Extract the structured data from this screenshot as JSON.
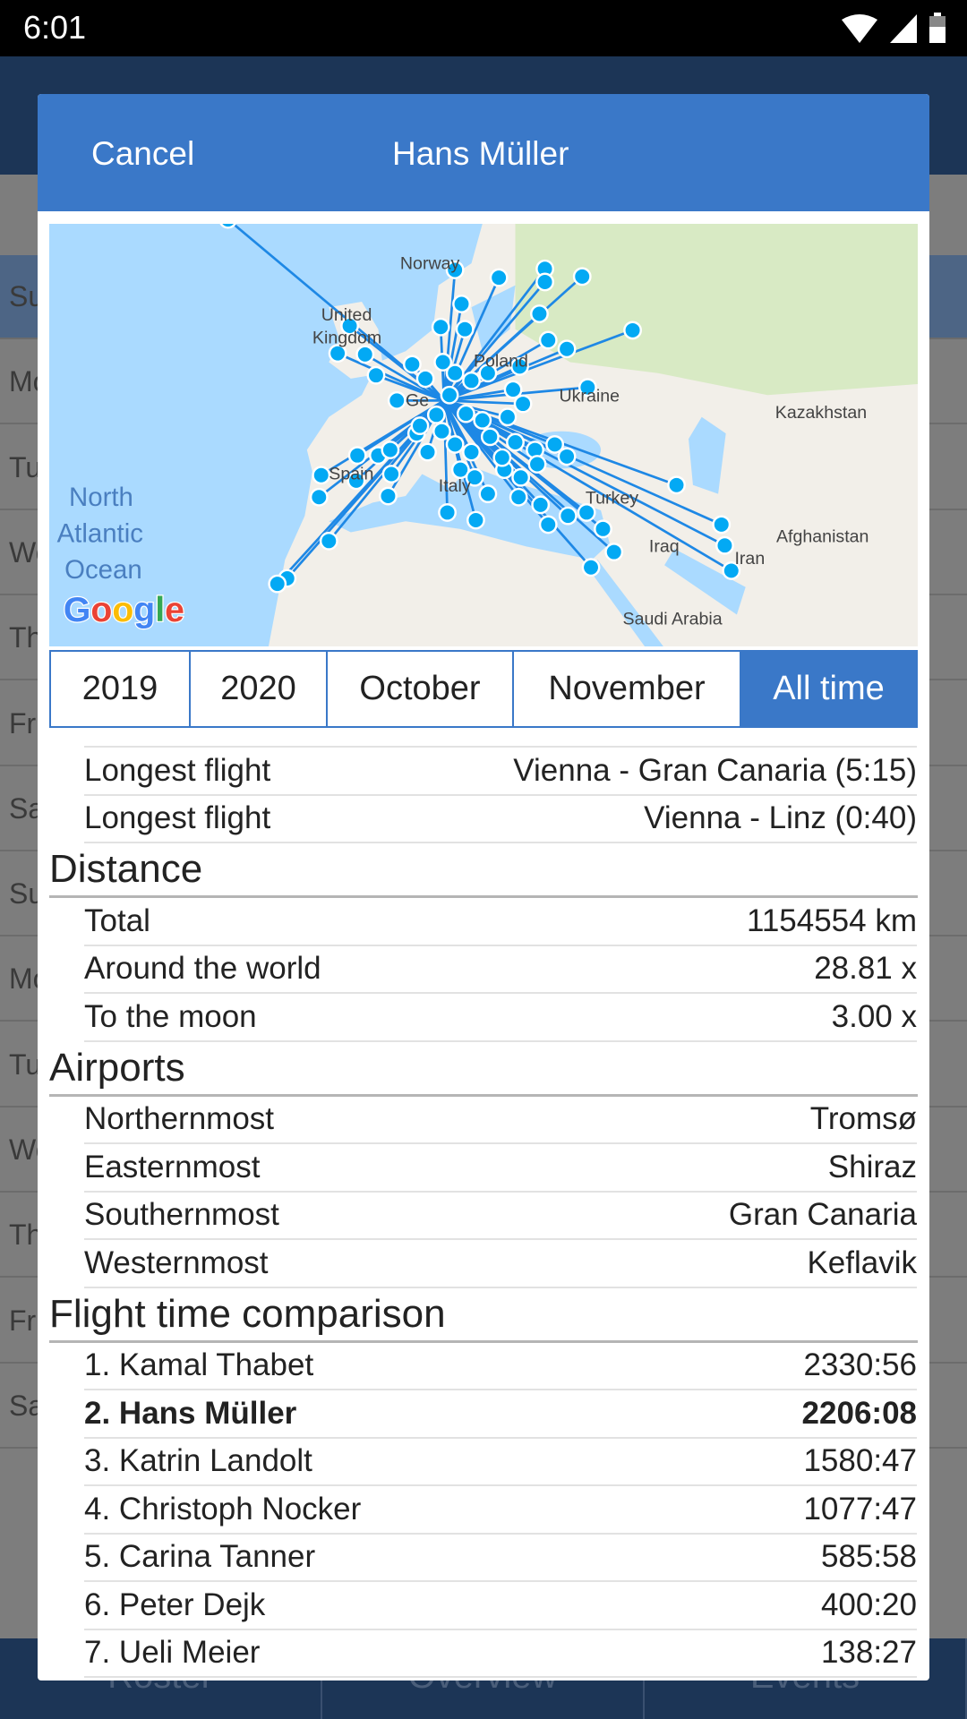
{
  "status_bar": {
    "time": "6:01"
  },
  "background": {
    "days": [
      "Su",
      "Mo",
      "Tu",
      "We",
      "Th",
      "Fr",
      "Sa",
      "Su",
      "Mo",
      "Tu",
      "We",
      "Th",
      "Fr",
      "Sa"
    ],
    "nav": [
      "Roster",
      "Overview",
      "Events"
    ]
  },
  "dialog": {
    "cancel_label": "Cancel",
    "title": "Hans Müller"
  },
  "map": {
    "labels": {
      "norway": "Norway",
      "uk1": "United",
      "uk2": "Kingdom",
      "poland": "Poland",
      "ukraine": "Ukraine",
      "kazakhstan": "Kazakhstan",
      "germany": "Ge",
      "spain": "Spain",
      "italy": "Italy",
      "turkey": "Turkey",
      "iraq": "Iraq",
      "iran": "Iran",
      "afghanistan": "Afghanistan",
      "saudi": "Saudi Arabia",
      "ocean1": "North",
      "ocean2": "Atlantic",
      "ocean3": "Ocean"
    },
    "logo": "Google",
    "colors": {
      "route": "#1e88e5",
      "dot": "#03a9f4",
      "sea": "#aadaff",
      "land": "#f2efe9"
    }
  },
  "periods": [
    "2019",
    "2020",
    "October",
    "November",
    "All time"
  ],
  "selected_period": "All time",
  "flights": [
    {
      "label": "Longest flight",
      "value": "Vienna - Gran Canaria (5:15)"
    },
    {
      "label": "Longest flight",
      "value": "Vienna - Linz (0:40)"
    }
  ],
  "distance": {
    "title": "Distance",
    "rows": [
      {
        "label": "Total",
        "value": "1154554 km"
      },
      {
        "label": "Around the world",
        "value": "28.81 x"
      },
      {
        "label": "To the moon",
        "value": "3.00 x"
      }
    ]
  },
  "airports": {
    "title": "Airports",
    "rows": [
      {
        "label": "Northernmost",
        "value": "Tromsø"
      },
      {
        "label": "Easternmost",
        "value": "Shiraz"
      },
      {
        "label": "Southernmost",
        "value": "Gran Canaria"
      },
      {
        "label": "Westernmost",
        "value": "Keflavik"
      }
    ]
  },
  "comparison": {
    "title": "Flight time comparison",
    "rows": [
      {
        "label": "1. Kamal Thabet",
        "value": "2330:56"
      },
      {
        "label": "2. Hans Müller",
        "value": "2206:08",
        "current": true
      },
      {
        "label": "3. Katrin Landolt",
        "value": "1580:47"
      },
      {
        "label": "4. Christoph Nocker",
        "value": "1077:47"
      },
      {
        "label": "5. Carina Tanner",
        "value": "585:58"
      },
      {
        "label": "6. Peter Dejk",
        "value": "400:20"
      },
      {
        "label": "7. Ueli Meier",
        "value": "138:27"
      }
    ]
  }
}
